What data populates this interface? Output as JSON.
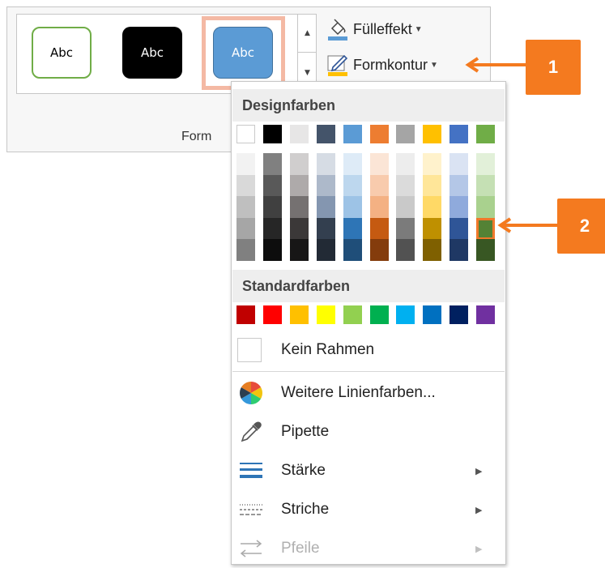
{
  "ribbon": {
    "gallery_samples": [
      "Abc",
      "Abc",
      "Abc"
    ],
    "fill_effect_label": "Fülleffekt",
    "shape_outline_label": "Formkontur",
    "group_label": "Form"
  },
  "menu": {
    "theme_colors_header": "Designfarben",
    "standard_colors_header": "Standardfarben",
    "theme_base_colors": [
      "#ffffff",
      "#000000",
      "#e7e6e6",
      "#44546a",
      "#5b9bd5",
      "#ed7d31",
      "#a5a5a5",
      "#ffc000",
      "#4472c4",
      "#70ad47"
    ],
    "theme_shades": [
      [
        "#f2f2f2",
        "#d9d9d9",
        "#bfbfbf",
        "#a6a6a6",
        "#808080"
      ],
      [
        "#808080",
        "#595959",
        "#404040",
        "#262626",
        "#0d0d0d"
      ],
      [
        "#d0cece",
        "#aeaaaa",
        "#757171",
        "#3b3838",
        "#171616"
      ],
      [
        "#d6dce4",
        "#adb9ca",
        "#8496b0",
        "#333f4f",
        "#222a35"
      ],
      [
        "#deebf7",
        "#bdd7ee",
        "#9dc3e6",
        "#2e75b6",
        "#1f4e79"
      ],
      [
        "#fbe5d6",
        "#f8cbad",
        "#f4b183",
        "#c55a11",
        "#843c0c"
      ],
      [
        "#ededed",
        "#dbdbdb",
        "#c9c9c9",
        "#7b7b7b",
        "#525252"
      ],
      [
        "#fff2cc",
        "#ffe699",
        "#ffd966",
        "#bf9000",
        "#7f6000"
      ],
      [
        "#dae3f3",
        "#b4c7e7",
        "#8faadc",
        "#2f5597",
        "#1f3864"
      ],
      [
        "#e2f0d9",
        "#c5e0b4",
        "#a9d18e",
        "#548235",
        "#385723"
      ]
    ],
    "selected_shade": {
      "column": 9,
      "row": 3
    },
    "standard_colors": [
      "#c00000",
      "#ff0000",
      "#ffc000",
      "#ffff00",
      "#92d050",
      "#00b050",
      "#00b0f0",
      "#0070c0",
      "#002060",
      "#7030a0"
    ],
    "no_outline_label": "Kein Rahmen",
    "more_colors_label": "Weitere Linienfarben...",
    "eyedropper_label": "Pipette",
    "weight_label": "Stärke",
    "dashes_label": "Striche",
    "arrows_label": "Pfeile"
  },
  "callouts": [
    "1",
    "2"
  ],
  "accent_color": "#f47a1f"
}
